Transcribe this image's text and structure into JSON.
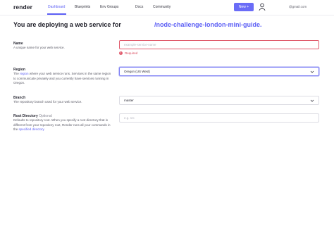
{
  "nav": {
    "logo": "render",
    "items": [
      "Dashboard",
      "Blueprints",
      "Env Groups",
      "Docs",
      "Community"
    ],
    "new_button": "New +",
    "email": "@gmail.com"
  },
  "heading": {
    "prefix": "You are deploying a web service for",
    "repo": "/node-challenge-london-mini-guide."
  },
  "fields": {
    "name": {
      "label": "Name",
      "description": "A unique name for your web service.",
      "placeholder": "example-service-name",
      "error": "Required"
    },
    "region": {
      "label": "Region",
      "desc_1": "The ",
      "desc_link": "region",
      "desc_2": " where your web service runs. Services in the same region to communicate privately and you currently have services running in Oregon.",
      "value": "Oregon (US West)"
    },
    "branch": {
      "label": "Branch",
      "description": "The repository branch used for your web service.",
      "value": "master"
    },
    "root_directory": {
      "label": "Root Directory",
      "optional": "Optional",
      "desc_1": "Defaults to repository root. When you specify a root directory that is different from your repository root, Render runs all your commands in the ",
      "desc_link": "specified directory",
      "placeholder": "e.g. src"
    }
  },
  "colors": {
    "accent": "#5c5ff5",
    "error": "#e05a6c",
    "button": "#6a6cf7"
  }
}
